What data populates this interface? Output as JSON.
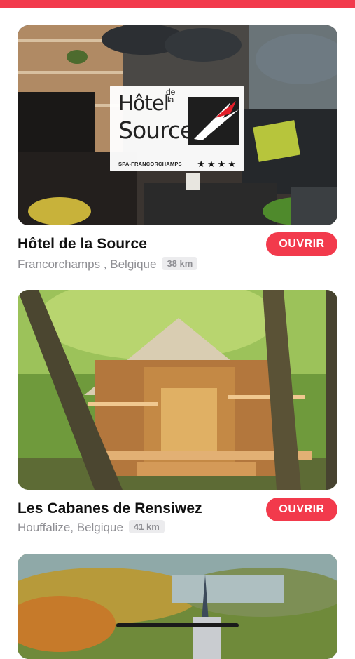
{
  "header": {
    "accent_color": "#f23a4c"
  },
  "listings": [
    {
      "name": "Hôtel de la Source",
      "location": "Francorchamps , Belgique",
      "distance": "38 km",
      "button_label": "OUVRIR",
      "image": "hotel-lounge-photo",
      "logo": {
        "line1": "Hôtel",
        "line2": "Source",
        "small": "de\nla",
        "subtitle": "SPA-FRANCORCHAMPS",
        "stars": "★★★★"
      }
    },
    {
      "name": "Les Cabanes de Rensiwez",
      "location": "Houffalize, Belgique",
      "distance": "41 km",
      "button_label": "OUVRIR",
      "image": "forest-cabin-photo"
    },
    {
      "image": "valley-town-photo"
    }
  ],
  "colors": {
    "button": "#f23a4c",
    "badge_bg": "#ececee",
    "muted_text": "#8e8e93"
  }
}
